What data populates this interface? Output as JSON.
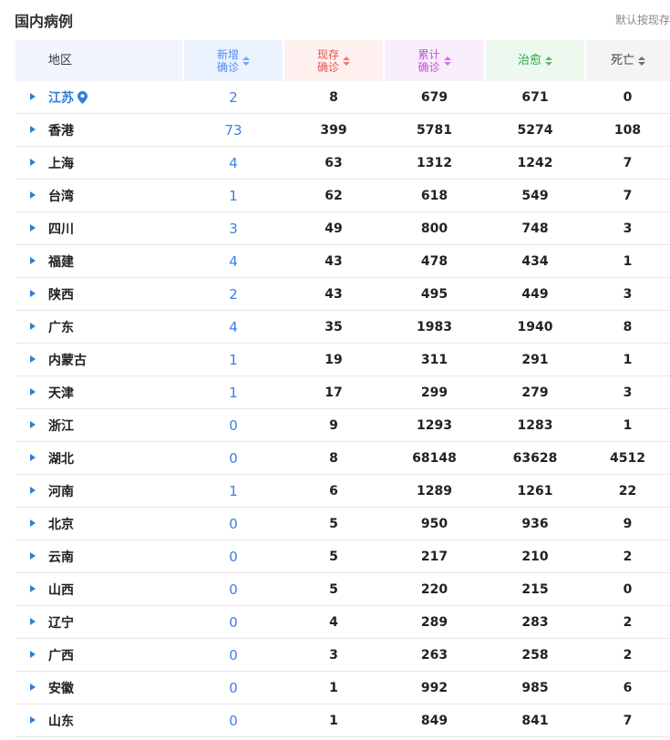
{
  "title": "国内病例",
  "sort_note": "默认按现存",
  "headers": {
    "region": "地区",
    "new_l1": "新增",
    "new_l2": "确诊",
    "cur_l1": "现存",
    "cur_l2": "确诊",
    "total_l1": "累计",
    "total_l2": "确诊",
    "cured": "治愈",
    "dead": "死亡"
  },
  "colors": {
    "new": "#4c8ef5",
    "current": "#e6534b",
    "total": "#c04fd9",
    "cured": "#2ea64b",
    "dead": "#444444",
    "link": "#2f7ed8"
  },
  "rows": [
    {
      "region": "江苏",
      "new": "2",
      "current": "8",
      "total": "679",
      "cured": "671",
      "dead": "0"
    },
    {
      "region": "香港",
      "new": "73",
      "current": "399",
      "total": "5781",
      "cured": "5274",
      "dead": "108"
    },
    {
      "region": "上海",
      "new": "4",
      "current": "63",
      "total": "1312",
      "cured": "1242",
      "dead": "7"
    },
    {
      "region": "台湾",
      "new": "1",
      "current": "62",
      "total": "618",
      "cured": "549",
      "dead": "7"
    },
    {
      "region": "四川",
      "new": "3",
      "current": "49",
      "total": "800",
      "cured": "748",
      "dead": "3"
    },
    {
      "region": "福建",
      "new": "4",
      "current": "43",
      "total": "478",
      "cured": "434",
      "dead": "1"
    },
    {
      "region": "陕西",
      "new": "2",
      "current": "43",
      "total": "495",
      "cured": "449",
      "dead": "3"
    },
    {
      "region": "广东",
      "new": "4",
      "current": "35",
      "total": "1983",
      "cured": "1940",
      "dead": "8"
    },
    {
      "region": "内蒙古",
      "new": "1",
      "current": "19",
      "total": "311",
      "cured": "291",
      "dead": "1"
    },
    {
      "region": "天津",
      "new": "1",
      "current": "17",
      "total": "299",
      "cured": "279",
      "dead": "3"
    },
    {
      "region": "浙江",
      "new": "0",
      "current": "9",
      "total": "1293",
      "cured": "1283",
      "dead": "1"
    },
    {
      "region": "湖北",
      "new": "0",
      "current": "8",
      "total": "68148",
      "cured": "63628",
      "dead": "4512"
    },
    {
      "region": "河南",
      "new": "1",
      "current": "6",
      "total": "1289",
      "cured": "1261",
      "dead": "22"
    },
    {
      "region": "北京",
      "new": "0",
      "current": "5",
      "total": "950",
      "cured": "936",
      "dead": "9"
    },
    {
      "region": "云南",
      "new": "0",
      "current": "5",
      "total": "217",
      "cured": "210",
      "dead": "2"
    },
    {
      "region": "山西",
      "new": "0",
      "current": "5",
      "total": "220",
      "cured": "215",
      "dead": "0"
    },
    {
      "region": "辽宁",
      "new": "0",
      "current": "4",
      "total": "289",
      "cured": "283",
      "dead": "2"
    },
    {
      "region": "广西",
      "new": "0",
      "current": "3",
      "total": "263",
      "cured": "258",
      "dead": "2"
    },
    {
      "region": "安徽",
      "new": "0",
      "current": "1",
      "total": "992",
      "cured": "985",
      "dead": "6"
    },
    {
      "region": "山东",
      "new": "0",
      "current": "1",
      "total": "849",
      "cured": "841",
      "dead": "7"
    }
  ]
}
